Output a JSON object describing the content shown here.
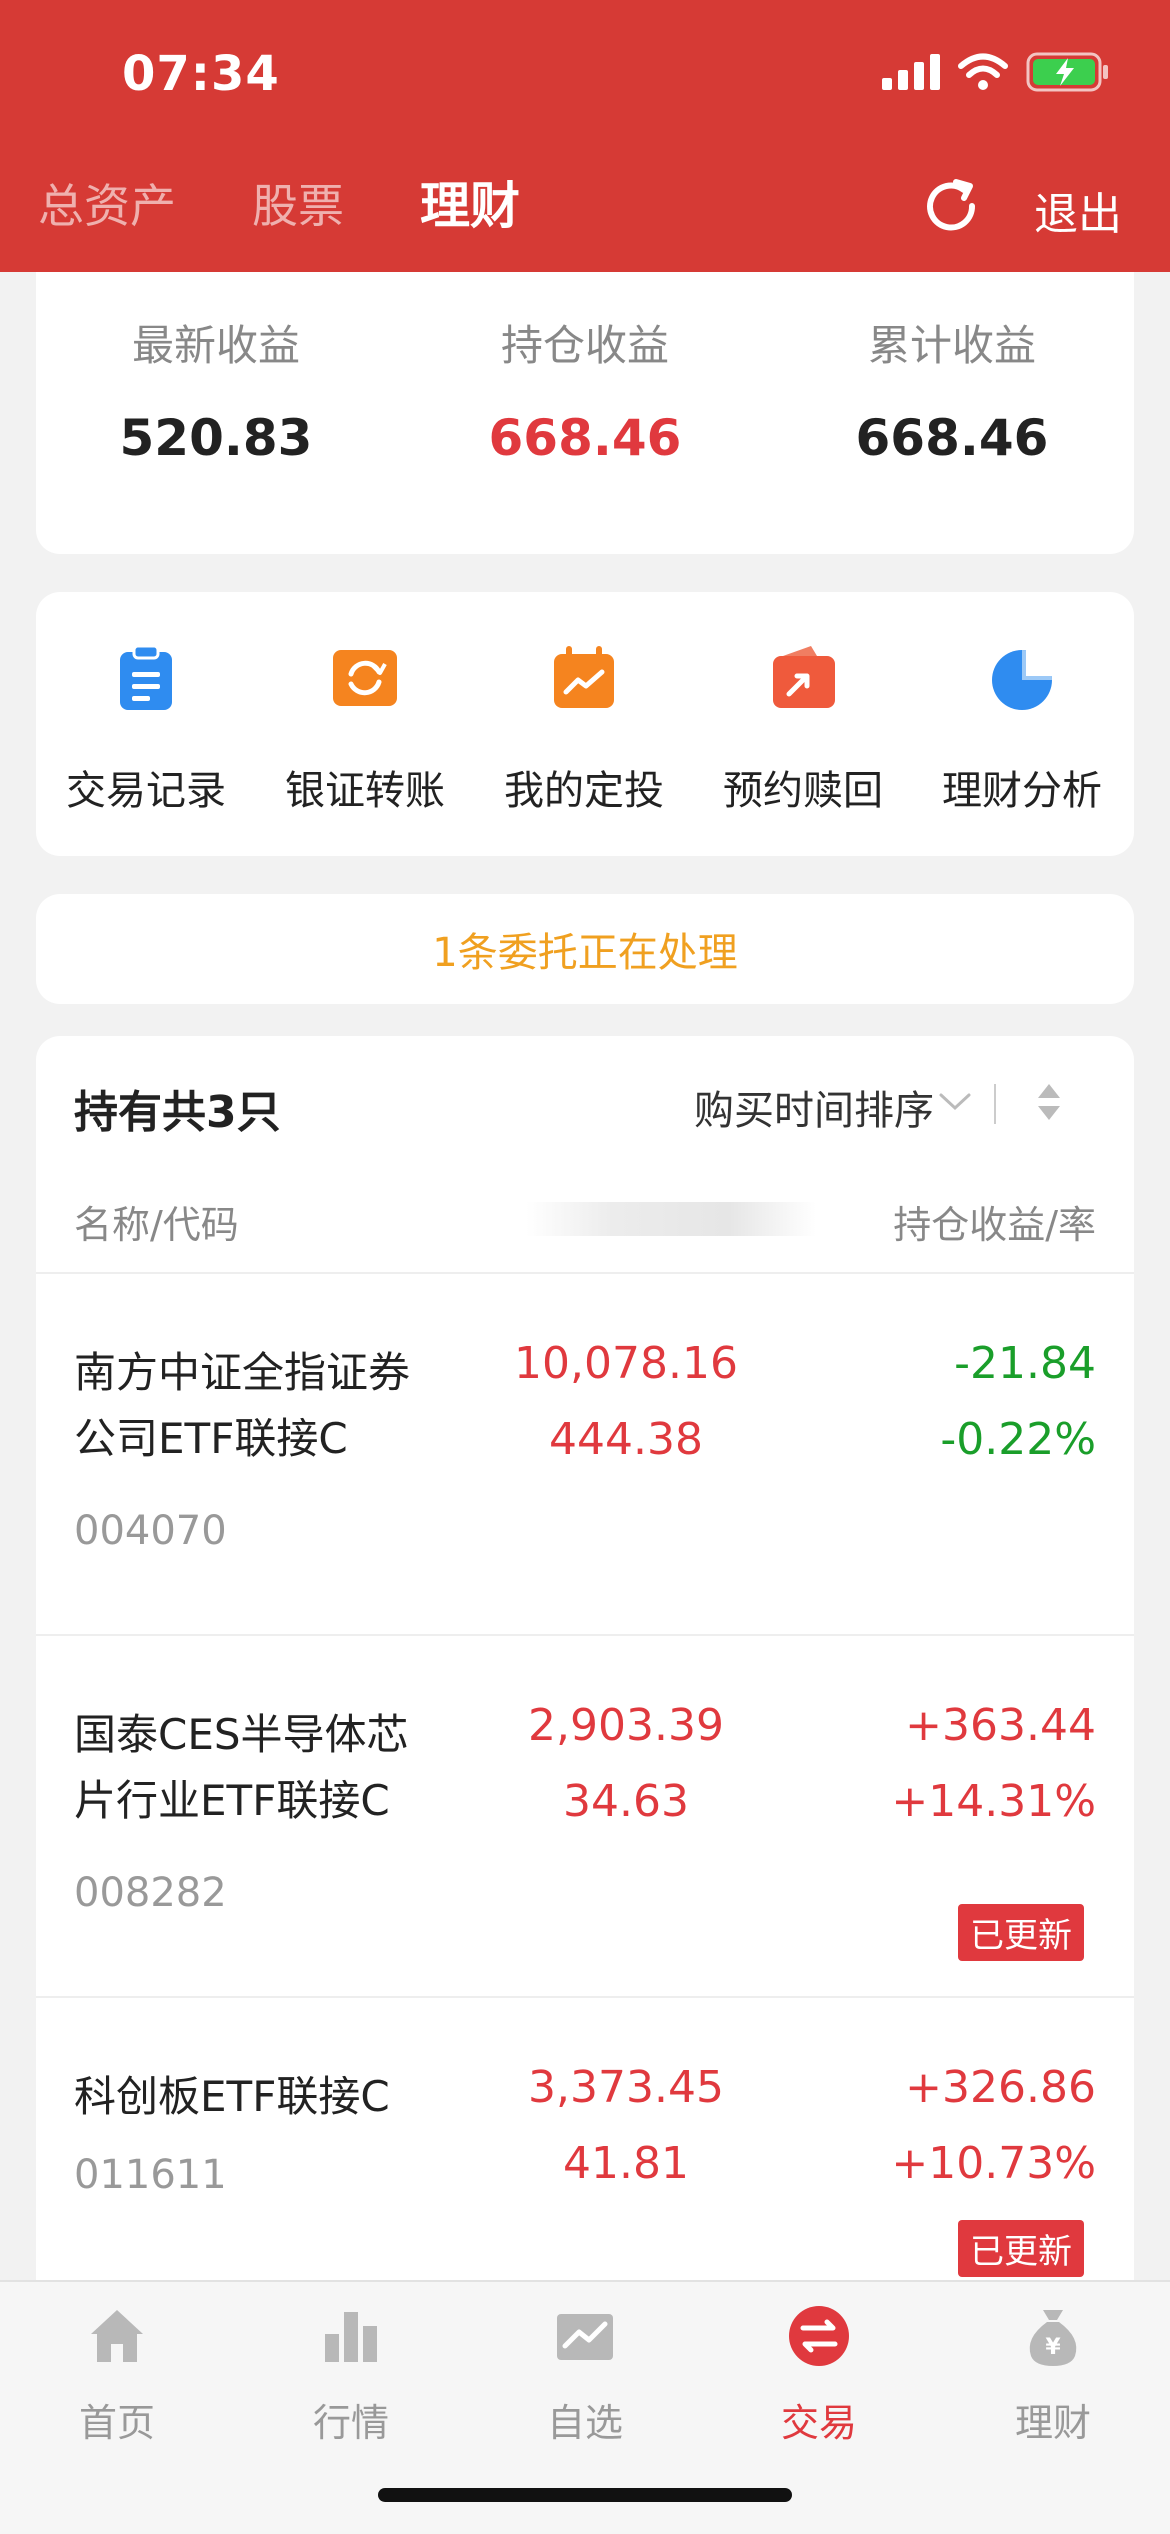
{
  "status": {
    "time": "07:34"
  },
  "nav": {
    "tabs": [
      "总资产",
      "股票",
      "理财"
    ],
    "active": "理财",
    "exit_label": "退出"
  },
  "summary": [
    {
      "label": "最新收益",
      "value": "520.83",
      "color": "#222222"
    },
    {
      "label": "持仓收益",
      "value": "668.46",
      "color": "#e0393e"
    },
    {
      "label": "累计收益",
      "value": "668.46",
      "color": "#222222"
    }
  ],
  "quick_actions": [
    {
      "label": "交易记录",
      "icon": "clipboard-icon"
    },
    {
      "label": "银证转账",
      "icon": "transfer-icon"
    },
    {
      "label": "我的定投",
      "icon": "calendar-icon"
    },
    {
      "label": "预约赎回",
      "icon": "redeem-icon"
    },
    {
      "label": "理财分析",
      "icon": "pie-chart-icon"
    }
  ],
  "notice": "1条委托正在处理",
  "holdings": {
    "title": "持有共3只",
    "sort_label": "购买时间排序",
    "col_name": "名称/代码",
    "col_profit": "持仓收益/率",
    "rows": [
      {
        "name_line1": "南方中证全指证券",
        "name_line2": "公司ETF联接C",
        "code": "004070",
        "value": "10,078.16",
        "amount": "444.38",
        "profit": "-21.84",
        "rate": "-0.22%",
        "badge": ""
      },
      {
        "name_line1": "国泰CES半导体芯",
        "name_line2": "片行业ETF联接C",
        "code": "008282",
        "value": "2,903.39",
        "amount": "34.63",
        "profit": "+363.44",
        "rate": "+14.31%",
        "badge": "已更新"
      },
      {
        "name_line1": "科创板ETF联接C",
        "name_line2": "",
        "code": "011611",
        "value": "3,373.45",
        "amount": "41.81",
        "profit": "+326.86",
        "rate": "+10.73%",
        "badge": "已更新"
      }
    ]
  },
  "tabbar": [
    {
      "label": "首页",
      "icon": "home-icon"
    },
    {
      "label": "行情",
      "icon": "market-icon"
    },
    {
      "label": "自选",
      "icon": "watchlist-icon"
    },
    {
      "label": "交易",
      "icon": "trade-icon"
    },
    {
      "label": "理财",
      "icon": "money-bag-icon"
    }
  ],
  "tabbar_active": "交易"
}
